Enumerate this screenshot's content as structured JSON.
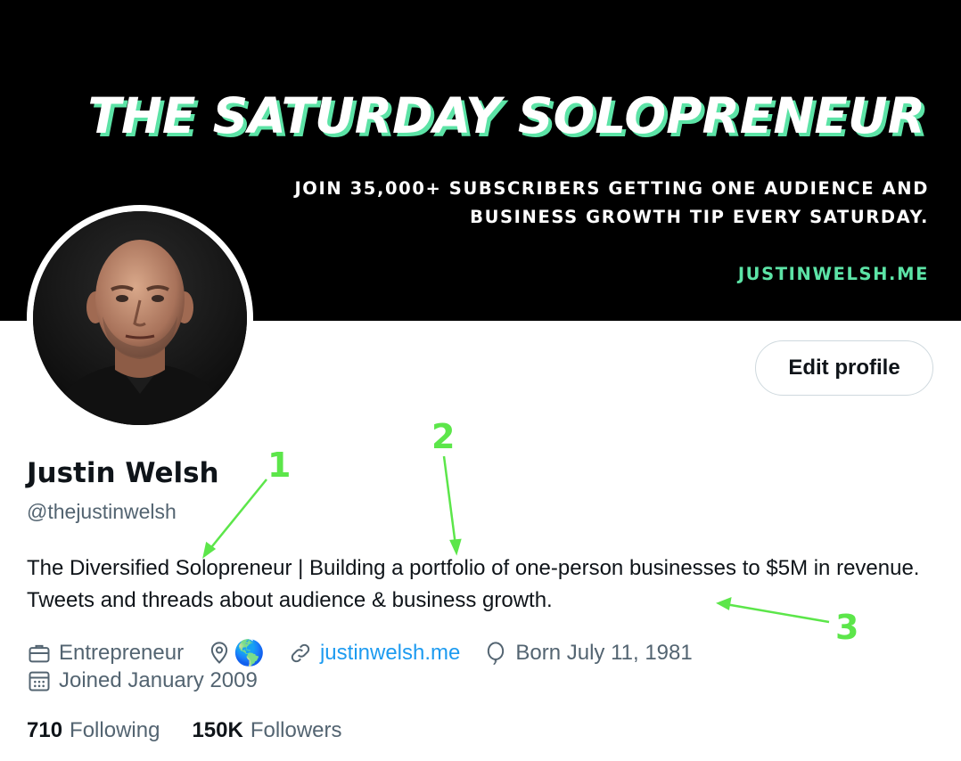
{
  "banner": {
    "title": "THE SATURDAY SOLOPRENEUR",
    "subtitle_line1": "JOIN 35,000+ SUBSCRIBERS GETTING ONE AUDIENCE AND",
    "subtitle_line2": "BUSINESS GROWTH TIP EVERY SATURDAY.",
    "url": "JUSTINWELSH.ME"
  },
  "profile": {
    "edit_label": "Edit profile",
    "name": "Justin Welsh",
    "handle": "@thejustinwelsh",
    "bio": "The Diversified Solopreneur | Building a portfolio of one-person businesses to $5M in revenue. Tweets and threads about audience & business growth.",
    "category": "Entrepreneur",
    "location_emoji": "🌎",
    "website": "justinwelsh.me",
    "birthday": "Born July 11, 1981",
    "joined": "Joined January 2009"
  },
  "stats": {
    "following_count": "710",
    "following_label": "Following",
    "followers_count": "150K",
    "followers_label": "Followers"
  },
  "annotations": [
    "1",
    "2",
    "3"
  ],
  "colors": {
    "accent_green": "#5ce3a6",
    "link_blue": "#1d9bf0",
    "annotation_green": "#5ce64a",
    "secondary_text": "#536471"
  },
  "icons": [
    "briefcase-icon",
    "location-pin-icon",
    "link-icon",
    "balloon-icon",
    "calendar-icon"
  ]
}
